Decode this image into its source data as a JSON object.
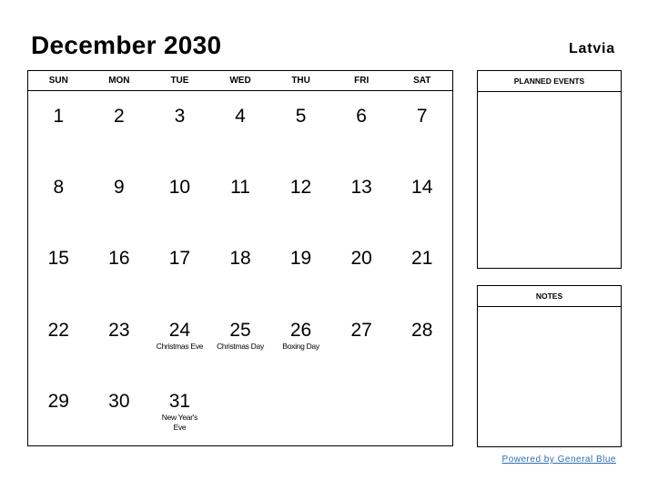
{
  "header": {
    "title": "December 2030",
    "country": "Latvia"
  },
  "calendar": {
    "weekdays": [
      "SUN",
      "MON",
      "TUE",
      "WED",
      "THU",
      "FRI",
      "SAT"
    ],
    "weeks": [
      [
        {
          "day": "1",
          "holiday": ""
        },
        {
          "day": "2",
          "holiday": ""
        },
        {
          "day": "3",
          "holiday": ""
        },
        {
          "day": "4",
          "holiday": ""
        },
        {
          "day": "5",
          "holiday": ""
        },
        {
          "day": "6",
          "holiday": ""
        },
        {
          "day": "7",
          "holiday": ""
        }
      ],
      [
        {
          "day": "8",
          "holiday": ""
        },
        {
          "day": "9",
          "holiday": ""
        },
        {
          "day": "10",
          "holiday": ""
        },
        {
          "day": "11",
          "holiday": ""
        },
        {
          "day": "12",
          "holiday": ""
        },
        {
          "day": "13",
          "holiday": ""
        },
        {
          "day": "14",
          "holiday": ""
        }
      ],
      [
        {
          "day": "15",
          "holiday": ""
        },
        {
          "day": "16",
          "holiday": ""
        },
        {
          "day": "17",
          "holiday": ""
        },
        {
          "day": "18",
          "holiday": ""
        },
        {
          "day": "19",
          "holiday": ""
        },
        {
          "day": "20",
          "holiday": ""
        },
        {
          "day": "21",
          "holiday": ""
        }
      ],
      [
        {
          "day": "22",
          "holiday": ""
        },
        {
          "day": "23",
          "holiday": ""
        },
        {
          "day": "24",
          "holiday": "Christmas Eve"
        },
        {
          "day": "25",
          "holiday": "Christmas Day"
        },
        {
          "day": "26",
          "holiday": "Boxing Day"
        },
        {
          "day": "27",
          "holiday": ""
        },
        {
          "day": "28",
          "holiday": ""
        }
      ],
      [
        {
          "day": "29",
          "holiday": ""
        },
        {
          "day": "30",
          "holiday": ""
        },
        {
          "day": "31",
          "holiday": "New Year's Eve"
        },
        {
          "day": "",
          "holiday": ""
        },
        {
          "day": "",
          "holiday": ""
        },
        {
          "day": "",
          "holiday": ""
        },
        {
          "day": "",
          "holiday": ""
        }
      ]
    ]
  },
  "panels": {
    "planned_events": "PLANNED EVENTS",
    "notes": "NOTES"
  },
  "footer": {
    "powered_by": "Powered by General Blue"
  }
}
